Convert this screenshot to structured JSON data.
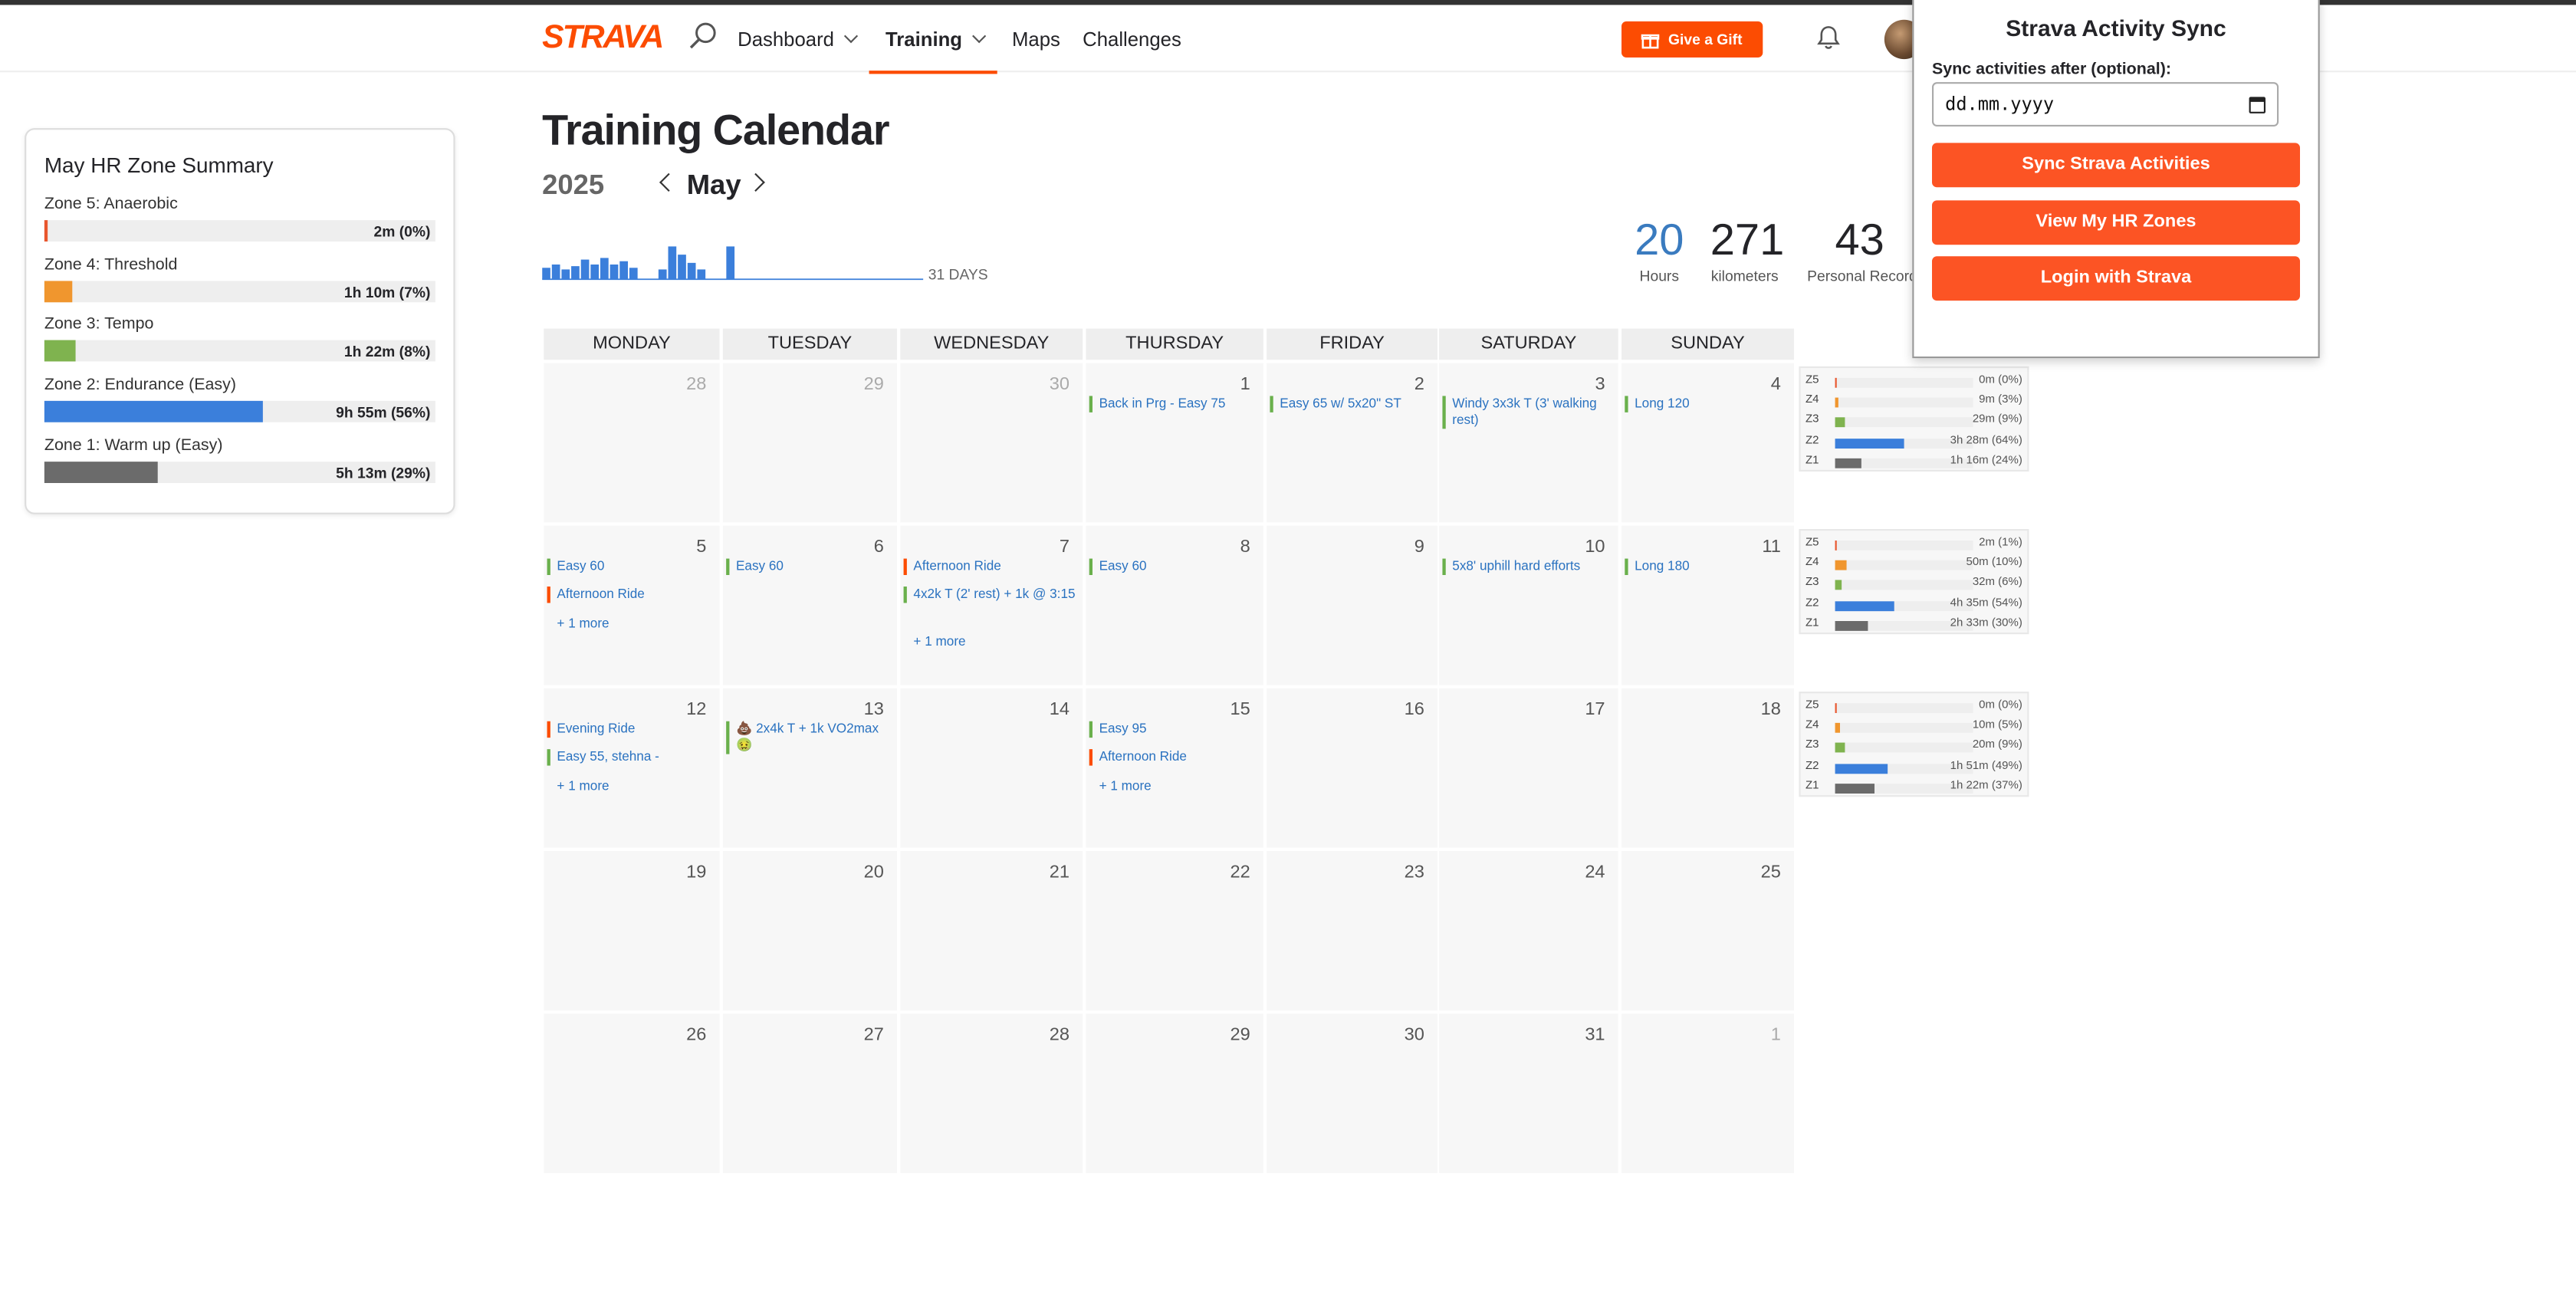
{
  "nav": {
    "logo": "STRAVA",
    "dashboard": "Dashboard",
    "training": "Training",
    "maps": "Maps",
    "challenges": "Challenges",
    "gift": "Give a Gift"
  },
  "summary": {
    "title": "May HR Zone Summary",
    "zones": [
      {
        "label": "Zone 5: Anaerobic",
        "value": "2m (0%)",
        "fraction": 0.005,
        "color": "#e8562e"
      },
      {
        "label": "Zone 4: Threshold",
        "value": "1h 10m (7%)",
        "fraction": 0.07,
        "color": "#f0962e"
      },
      {
        "label": "Zone 3: Tempo",
        "value": "1h 22m (8%)",
        "fraction": 0.08,
        "color": "#7fb34f"
      },
      {
        "label": "Zone 2: Endurance (Easy)",
        "value": "9h 55m (56%)",
        "fraction": 0.56,
        "color": "#3b7fdb"
      },
      {
        "label": "Zone 1: Warm up (Easy)",
        "value": "5h 13m (29%)",
        "fraction": 0.29,
        "color": "#6b6b6b"
      }
    ]
  },
  "header": {
    "title": "Training Calendar",
    "year": "2025",
    "month": "May",
    "days_label": "31 DAYS",
    "stats": [
      {
        "value": "20",
        "label": "Hours",
        "color": "#3a7bbf"
      },
      {
        "value": "271",
        "label": "kilometers",
        "color": "#242428"
      },
      {
        "value": "43",
        "label": "Personal Records",
        "color": "#242428"
      }
    ],
    "daily_bar_levels": [
      0.35,
      0.45,
      0.3,
      0.4,
      0.6,
      0.45,
      0.65,
      0.45,
      0.55,
      0.35,
      0,
      0,
      0.3,
      1,
      0.75,
      0.5,
      0.3,
      0,
      0,
      1,
      0,
      0,
      0,
      0,
      0,
      0,
      0,
      0,
      0,
      0,
      0
    ]
  },
  "calendar": {
    "weekdays": [
      "MONDAY",
      "TUESDAY",
      "WEDNESDAY",
      "THURSDAY",
      "FRIDAY",
      "SATURDAY",
      "SUNDAY"
    ],
    "weeks": [
      {
        "days": [
          {
            "num": "28",
            "other": true,
            "items": []
          },
          {
            "num": "29",
            "other": true,
            "items": []
          },
          {
            "num": "30",
            "other": true,
            "items": []
          },
          {
            "num": "1",
            "items": [
              {
                "t": "Back in Prg - Easy 75",
                "k": "run"
              }
            ]
          },
          {
            "num": "2",
            "items": [
              {
                "t": "Easy 65 w/ 5x20\" ST",
                "k": "run"
              }
            ]
          },
          {
            "num": "3",
            "items": [
              {
                "t": "Windy 3x3k T (3' walking rest)",
                "k": "run"
              }
            ]
          },
          {
            "num": "4",
            "items": [
              {
                "t": "Long 120",
                "k": "run"
              }
            ]
          }
        ],
        "hr": [
          {
            "z": "Z5",
            "v": "0m (0%)",
            "f": 0.0
          },
          {
            "z": "Z4",
            "v": "9m (3%)",
            "f": 0.03
          },
          {
            "z": "Z3",
            "v": "29m (9%)",
            "f": 0.09
          },
          {
            "z": "Z2",
            "v": "3h 28m (64%)",
            "f": 0.64
          },
          {
            "z": "Z1",
            "v": "1h 16m (24%)",
            "f": 0.24
          }
        ]
      },
      {
        "days": [
          {
            "num": "5",
            "items": [
              {
                "t": "Easy 60",
                "k": "run"
              },
              {
                "t": "Afternoon Ride",
                "k": "ride"
              }
            ],
            "more": "+ 1 more"
          },
          {
            "num": "6",
            "items": [
              {
                "t": "Easy 60",
                "k": "run"
              }
            ]
          },
          {
            "num": "7",
            "items": [
              {
                "t": "Afternoon Ride",
                "k": "ride"
              },
              {
                "t": "4x2k T (2' rest) + 1k @ 3:15",
                "k": "run"
              }
            ],
            "more": "+ 1 more"
          },
          {
            "num": "8",
            "items": [
              {
                "t": "Easy 60",
                "k": "run"
              }
            ]
          },
          {
            "num": "9",
            "items": []
          },
          {
            "num": "10",
            "items": [
              {
                "t": "5x8' uphill hard efforts",
                "k": "run"
              }
            ]
          },
          {
            "num": "11",
            "items": [
              {
                "t": "Long 180",
                "k": "run"
              }
            ]
          }
        ],
        "hr": [
          {
            "z": "Z5",
            "v": "2m (1%)",
            "f": 0.01
          },
          {
            "z": "Z4",
            "v": "50m (10%)",
            "f": 0.1
          },
          {
            "z": "Z3",
            "v": "32m (6%)",
            "f": 0.06
          },
          {
            "z": "Z2",
            "v": "4h 35m (54%)",
            "f": 0.54
          },
          {
            "z": "Z1",
            "v": "2h 33m (30%)",
            "f": 0.3
          }
        ]
      },
      {
        "days": [
          {
            "num": "12",
            "items": [
              {
                "t": "Evening Ride",
                "k": "ride"
              },
              {
                "t": "Easy 55, stehna -",
                "k": "run"
              }
            ],
            "more": "+ 1 more"
          },
          {
            "num": "13",
            "items": [
              {
                "t": "💩 2x4k T + 1k VO2max 🤢",
                "k": "run"
              }
            ]
          },
          {
            "num": "14",
            "items": []
          },
          {
            "num": "15",
            "items": [
              {
                "t": "Easy 95",
                "k": "run"
              },
              {
                "t": "Afternoon Ride",
                "k": "ride"
              }
            ],
            "more": "+ 1 more"
          },
          {
            "num": "16",
            "items": []
          },
          {
            "num": "17",
            "items": []
          },
          {
            "num": "18",
            "items": []
          }
        ],
        "hr": [
          {
            "z": "Z5",
            "v": "0m (0%)",
            "f": 0.0
          },
          {
            "z": "Z4",
            "v": "10m (5%)",
            "f": 0.05
          },
          {
            "z": "Z3",
            "v": "20m (9%)",
            "f": 0.09
          },
          {
            "z": "Z2",
            "v": "1h 51m (49%)",
            "f": 0.49
          },
          {
            "z": "Z1",
            "v": "1h 22m (37%)",
            "f": 0.37
          }
        ]
      },
      {
        "days": [
          {
            "num": "19",
            "items": []
          },
          {
            "num": "20",
            "items": []
          },
          {
            "num": "21",
            "items": []
          },
          {
            "num": "22",
            "items": []
          },
          {
            "num": "23",
            "items": []
          },
          {
            "num": "24",
            "items": []
          },
          {
            "num": "25",
            "items": []
          }
        ]
      },
      {
        "days": [
          {
            "num": "26",
            "items": []
          },
          {
            "num": "27",
            "items": []
          },
          {
            "num": "28",
            "items": []
          },
          {
            "num": "29",
            "items": []
          },
          {
            "num": "30",
            "items": []
          },
          {
            "num": "31",
            "items": []
          },
          {
            "num": "1",
            "other": true,
            "items": []
          }
        ]
      }
    ]
  },
  "popup": {
    "title": "Strava Activity Sync",
    "date_label": "Sync activities after (optional):",
    "date_placeholder": "dd.mm.yyyy",
    "sync_button": "Sync Strava Activities",
    "zones_button": "View My HR Zones",
    "login_button": "Login with Strava"
  },
  "colors": {
    "brand": "#fc4c02",
    "button": "#fc5424",
    "link": "#2a72c0",
    "run_marker": "#6ab04c",
    "ride_marker": "#fc4c02",
    "hr_zone_colors": [
      "#e8562e",
      "#f0962e",
      "#7fb34f",
      "#3b7fdb",
      "#6b6b6b"
    ]
  }
}
